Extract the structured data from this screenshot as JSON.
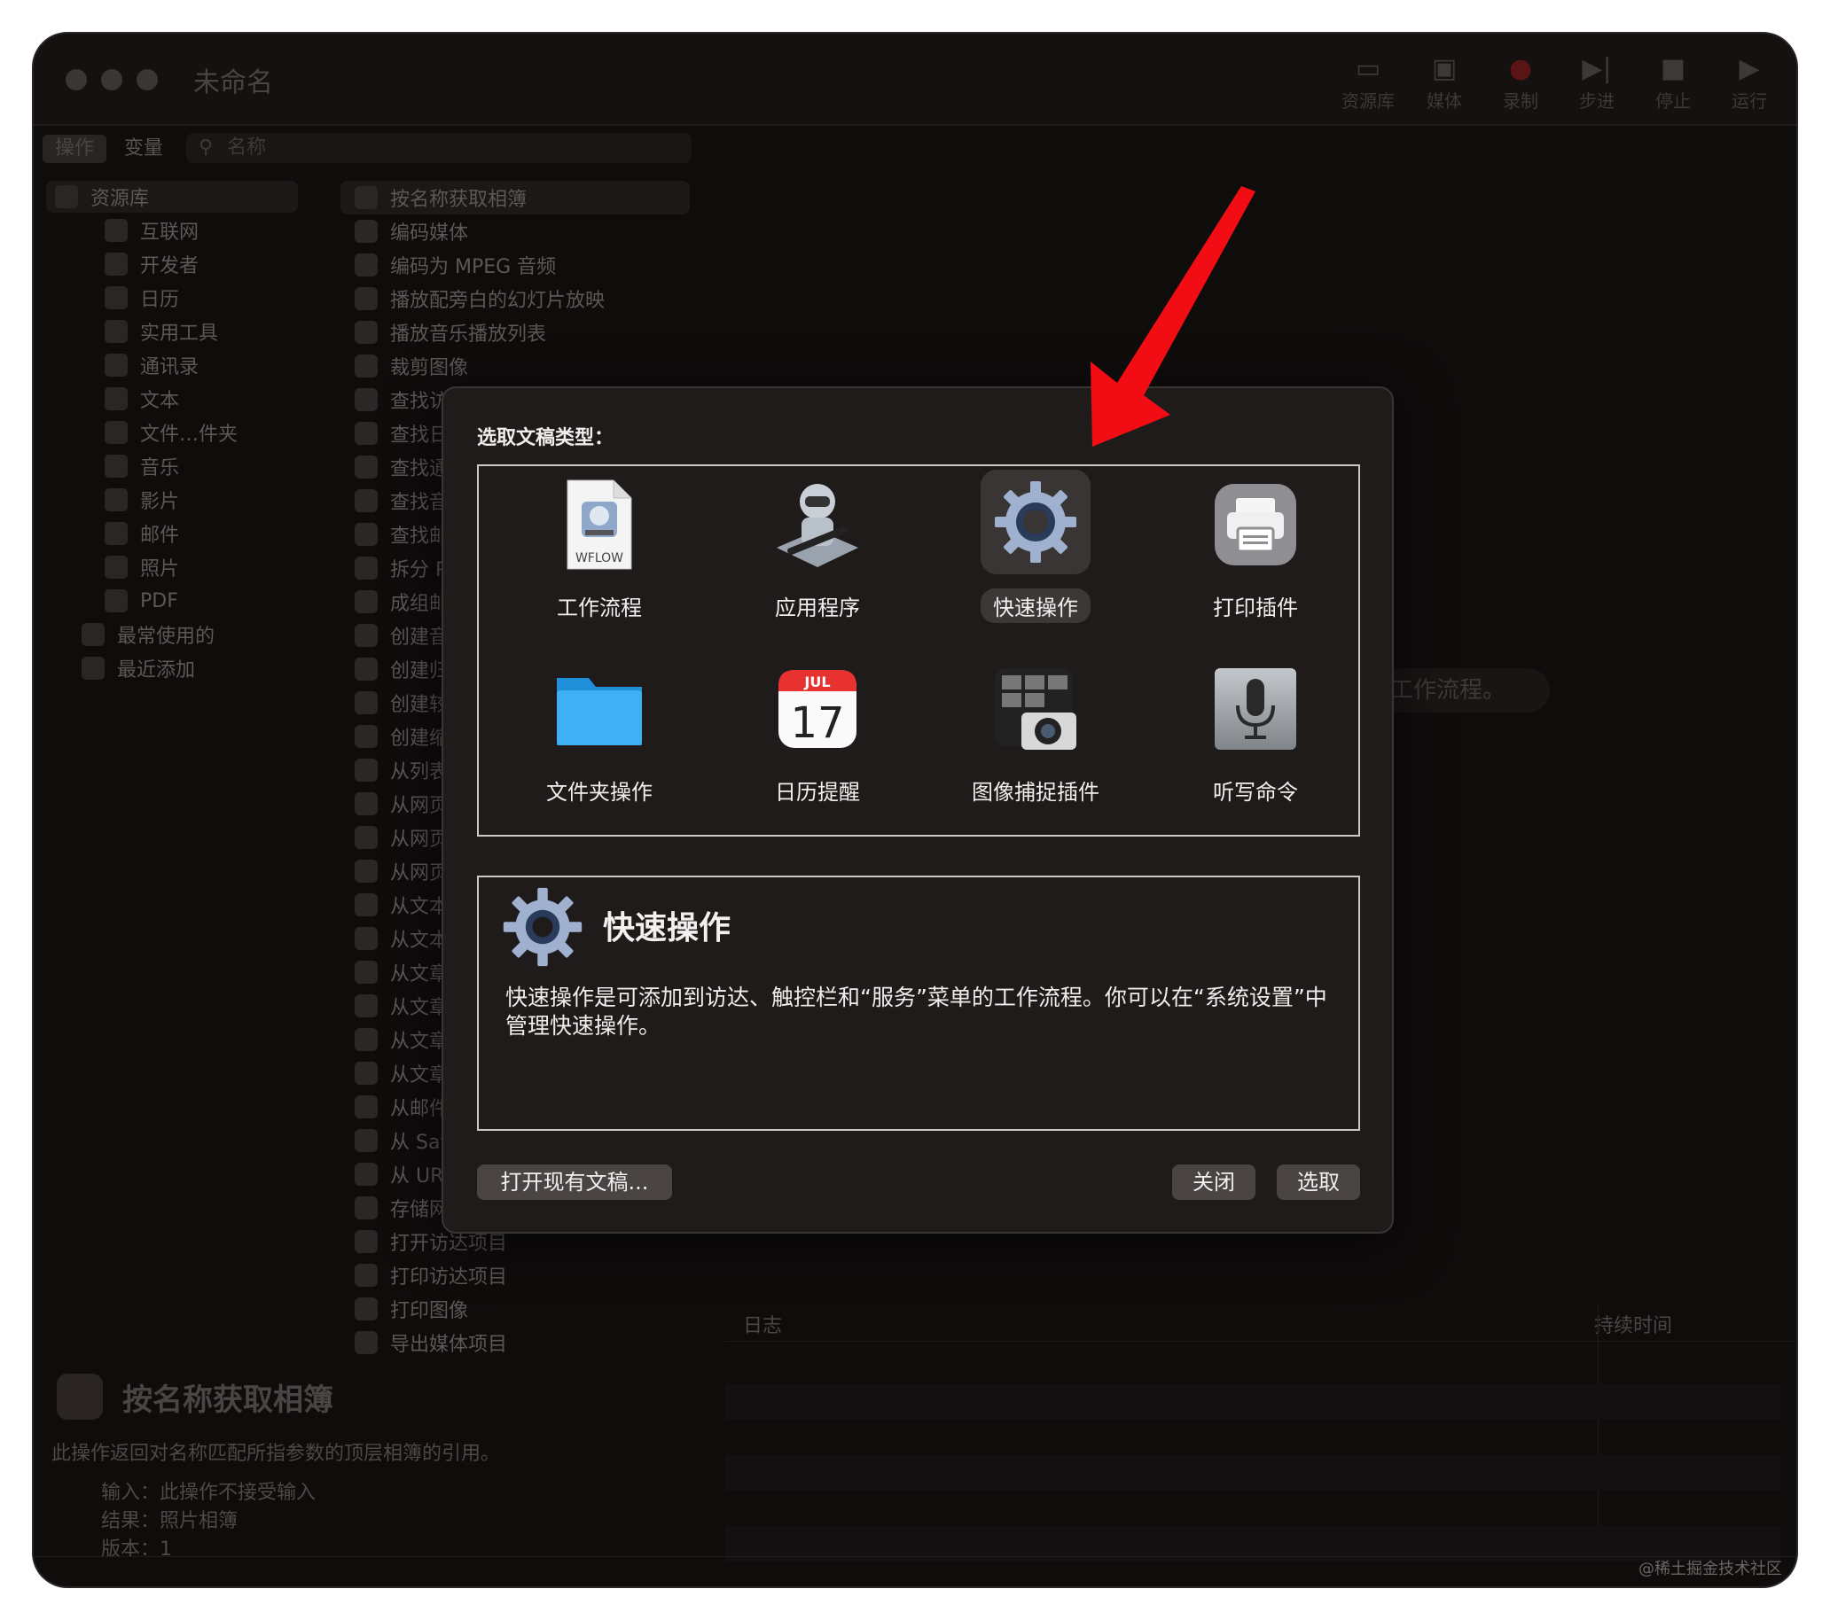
{
  "window": {
    "title": "未命名"
  },
  "toolbar": [
    {
      "label": "资源库",
      "icon": "library-icon"
    },
    {
      "label": "媒体",
      "icon": "media-icon"
    },
    {
      "label": "录制",
      "icon": "record-icon"
    },
    {
      "label": "步进",
      "icon": "step-icon"
    },
    {
      "label": "停止",
      "icon": "stop-icon"
    },
    {
      "label": "运行",
      "icon": "run-icon"
    }
  ],
  "sidebar": {
    "segments": [
      "操作",
      "变量"
    ],
    "search_placeholder": "名称",
    "library": [
      {
        "label": "资源库"
      },
      {
        "label": "互联网"
      },
      {
        "label": "开发者"
      },
      {
        "label": "日历"
      },
      {
        "label": "实用工具"
      },
      {
        "label": "通讯录"
      },
      {
        "label": "文本"
      },
      {
        "label": "文件…件夹"
      },
      {
        "label": "音乐"
      },
      {
        "label": "影片"
      },
      {
        "label": "邮件"
      },
      {
        "label": "照片"
      },
      {
        "label": "PDF"
      },
      {
        "label": "最常使用的"
      },
      {
        "label": "最近添加"
      }
    ],
    "actions": [
      "按名称获取相簿",
      "编码媒体",
      "编码为 MPEG 音频",
      "播放配旁白的幻灯片放映",
      "播放音乐播放列表",
      "裁剪图像",
      "查找访",
      "查找日",
      "查找通",
      "查找音",
      "查找邮",
      "拆分 P",
      "成组邮",
      "创建音",
      "创建归",
      "创建较",
      "创建缩",
      "从列表",
      "从网页",
      "从网页",
      "从网页",
      "从文本",
      "从文本",
      "从文章",
      "从文章",
      "从文章",
      "从文章",
      "从邮件",
      "从 Saf",
      "从 URL",
      "存储网",
      "打开访达项目",
      "打印访达项目",
      "打印图像",
      "导出媒体项目"
    ]
  },
  "info": {
    "title": "按名称获取相簿",
    "description": "此操作返回对名称匹配所指参数的顶层相簿的引用。",
    "input_label": "输入：",
    "input_value": "此操作不接受输入",
    "result_label": "结果：",
    "result_value": "照片相簿",
    "version_label": "版本：",
    "version_value": "1"
  },
  "log": {
    "col1": "日志",
    "col2": "持续时间",
    "ghost": "工作流程。"
  },
  "dialog": {
    "prompt": "选取文稿类型：",
    "types": [
      {
        "label": "工作流程",
        "icon": "workflow-icon",
        "badge": "WFLOW"
      },
      {
        "label": "应用程序",
        "icon": "automator-robot-icon"
      },
      {
        "label": "快速操作",
        "icon": "gear-icon",
        "selected": true
      },
      {
        "label": "打印插件",
        "icon": "printer-icon"
      },
      {
        "label": "文件夹操作",
        "icon": "folder-icon"
      },
      {
        "label": "日历提醒",
        "icon": "calendar-icon",
        "month": "JUL",
        "day": "17"
      },
      {
        "label": "图像捕捉插件",
        "icon": "image-capture-icon"
      },
      {
        "label": "听写命令",
        "icon": "microphone-icon"
      }
    ],
    "detail_title": "快速操作",
    "detail_text": "快速操作是可添加到访达、触控栏和“服务”菜单的工作流程。你可以在“系统设置”中管理快速操作。",
    "open_button": "打开现有文稿...",
    "close_button": "关闭",
    "choose_button": "选取"
  },
  "watermark": "@稀土掘金技术社区",
  "colors": {
    "arrow": "#f20d14",
    "selection": "#3d3838"
  }
}
